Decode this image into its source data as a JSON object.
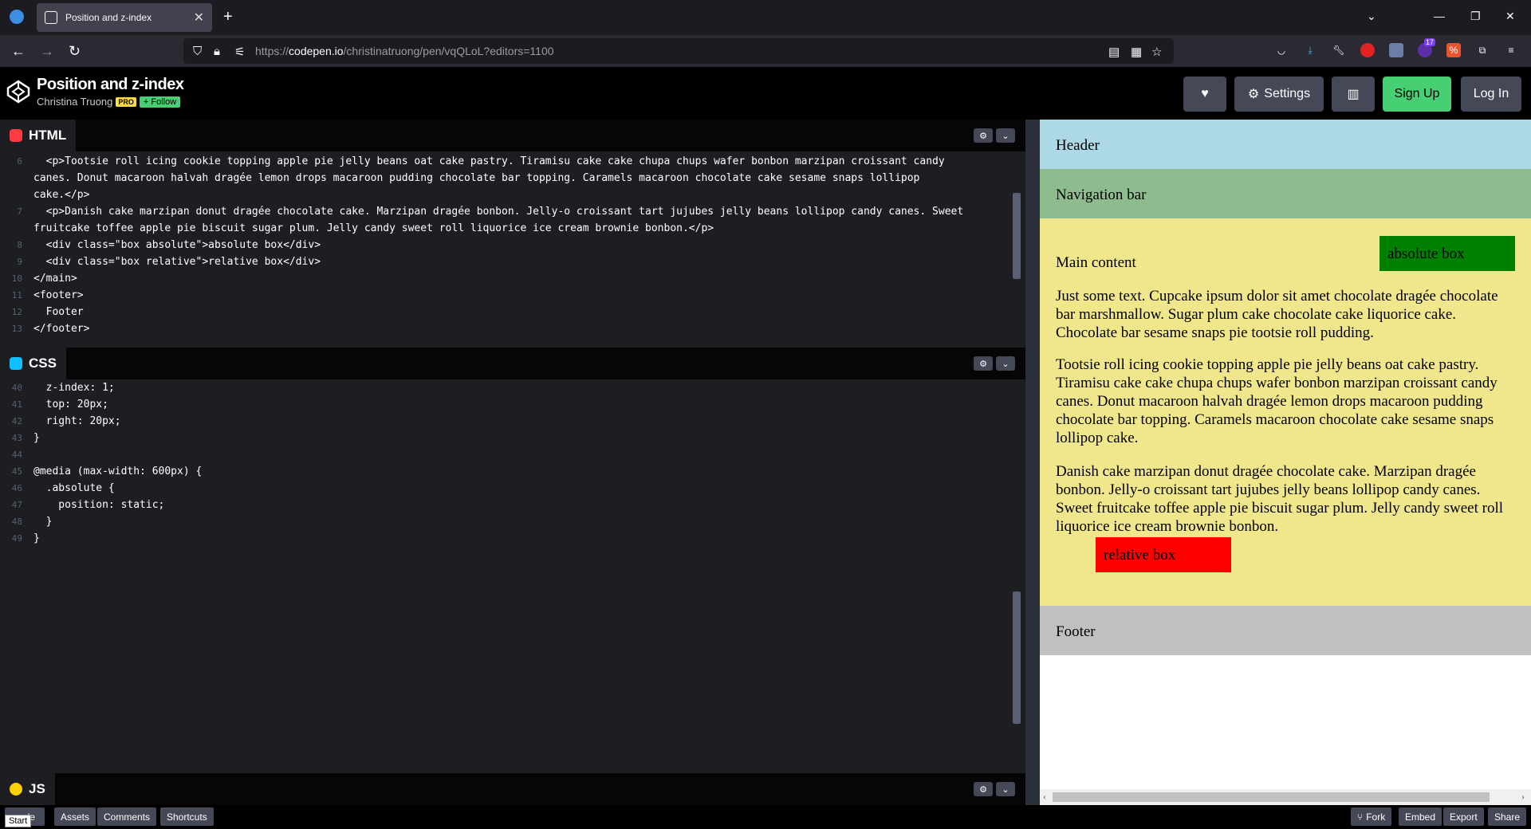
{
  "browser": {
    "tab_title": "Position and z-index",
    "url_prefix": "https://",
    "url_domain": "codepen.io",
    "url_path": "/christinatruong/pen/vqQLoL?editors=1100",
    "ext_badge": "17"
  },
  "header": {
    "title": "Position and z-index",
    "author": "Christina Truong",
    "pro_badge": "PRO",
    "follow_label": "+ Follow",
    "settings_label": "Settings",
    "signup_label": "Sign Up",
    "login_label": "Log In"
  },
  "html_pane": {
    "label": "HTML",
    "lines": [
      {
        "n": "6",
        "text": "  <p>Tootsie roll icing cookie topping apple pie jelly beans oat cake pastry. Tiramisu cake cake chupa chups wafer bonbon marzipan croissant candy"
      },
      {
        "n": "",
        "text": "canes. Donut macaroon halvah dragée lemon drops macaroon pudding chocolate bar topping. Caramels macaroon chocolate cake sesame snaps lollipop"
      },
      {
        "n": "",
        "text": "cake.</p>"
      },
      {
        "n": "7",
        "text": "  <p>Danish cake marzipan donut dragée chocolate cake. Marzipan dragée bonbon. Jelly-o croissant tart jujubes jelly beans lollipop candy canes. Sweet"
      },
      {
        "n": "",
        "text": "fruitcake toffee apple pie biscuit sugar plum. Jelly candy sweet roll liquorice ice cream brownie bonbon.</p>"
      },
      {
        "n": "8",
        "text": "  <div class=\"box absolute\">absolute box</div>"
      },
      {
        "n": "9",
        "text": "  <div class=\"box relative\">relative box</div>"
      },
      {
        "n": "10",
        "text": "</main>"
      },
      {
        "n": "11",
        "text": "<footer>"
      },
      {
        "n": "12",
        "text": "  Footer"
      },
      {
        "n": "13",
        "text": "</footer>"
      }
    ]
  },
  "css_pane": {
    "label": "CSS",
    "lines": [
      {
        "n": "40",
        "text": "  z-index: 1;"
      },
      {
        "n": "41",
        "text": "  top: 20px;"
      },
      {
        "n": "42",
        "text": "  right: 20px;"
      },
      {
        "n": "43",
        "text": "}"
      },
      {
        "n": "44",
        "text": ""
      },
      {
        "n": "45",
        "text": "@media (max-width: 600px) {"
      },
      {
        "n": "46",
        "text": "  .absolute {"
      },
      {
        "n": "47",
        "text": "    position: static;"
      },
      {
        "n": "48",
        "text": "  }"
      },
      {
        "n": "49",
        "text": "}"
      }
    ]
  },
  "js_pane": {
    "label": "JS"
  },
  "preview": {
    "header": "Header",
    "nav": "Navigation bar",
    "main_heading": "Main content",
    "absolute_box": "absolute box",
    "p1": "Just some text. Cupcake ipsum dolor sit amet chocolate dragée chocolate bar marshmallow. Sugar plum cake chocolate cake liquorice cake. Chocolate bar sesame snaps pie tootsie roll pudding.",
    "p2": "Tootsie roll icing cookie topping apple pie jelly beans oat cake pastry. Tiramisu cake cake chupa chups wafer bonbon marzipan croissant candy canes. Donut macaroon halvah dragée lemon drops macaroon pudding chocolate bar topping. Caramels macaroon chocolate cake sesame snaps lollipop cake.",
    "p3": "Danish cake marzipan donut dragée chocolate cake. Marzipan dragée bonbon. Jelly-o croissant tart jujubes jelly beans lollipop candy canes. Sweet fruitcake toffee apple pie biscuit sugar plum. Jelly candy sweet roll liquorice ice cream brownie bonbon.",
    "relative_box": "relative box",
    "footer": "Footer"
  },
  "footer_bar": {
    "console_label": "ole",
    "start_tooltip": "Start",
    "assets_label": "Assets",
    "comments_label": "Comments",
    "shortcuts_label": "Shortcuts",
    "fork_label": "Fork",
    "embed_label": "Embed",
    "export_label": "Export",
    "share_label": "Share"
  },
  "colors": {
    "header_bg": "#add8e6",
    "nav_bg": "#8fbc8f",
    "main_bg": "#f0e68c",
    "footer_bg": "#c0c0c0",
    "absolute_box": "#008000",
    "relative_box": "#ff0000",
    "signup": "#47cf73"
  }
}
